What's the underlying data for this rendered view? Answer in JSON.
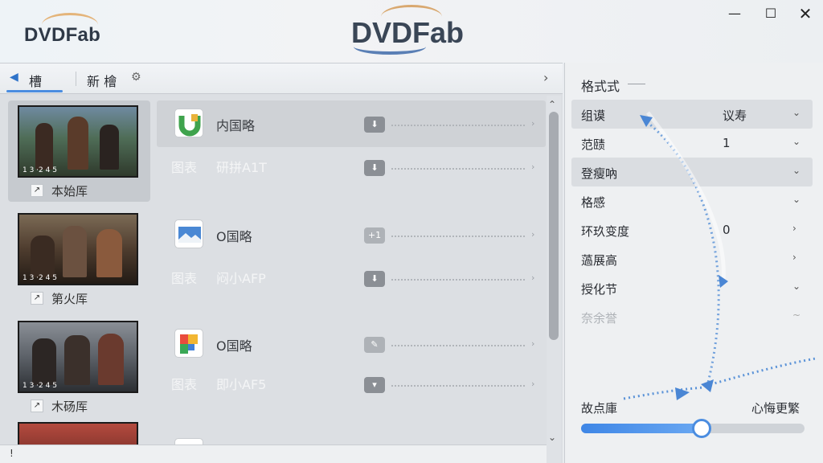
{
  "window": {
    "logo_small": "DVDFab",
    "logo_center": "DVDFab",
    "min_icon": "minimize-icon",
    "max_icon": "maximize-icon",
    "close_icon": "close-icon"
  },
  "tabs": {
    "tab1": "槽",
    "tab2": "新 檜",
    "gear_icon": "gear-icon",
    "back_icon": "back-arrow-icon",
    "next_icon": "chevron-right-icon"
  },
  "thumbnails": [
    {
      "caption": "1 3 ·2 4 5",
      "label": "本始厍"
    },
    {
      "caption": "1 3 ·2 4 5",
      "label": "第火厍"
    },
    {
      "caption": "1 3 ·2 4 5",
      "label": "木砀厍"
    }
  ],
  "rows": [
    {
      "title": "内国略",
      "sub_label": "图表",
      "sub_name": "研拼A1T",
      "badge1": "⬇",
      "badge2": "⬇"
    },
    {
      "title": "O国略",
      "sub_label": "图表",
      "sub_name": "闷小AFP",
      "badge1": "+1",
      "badge2": "⬇"
    },
    {
      "title": "O国略",
      "sub_label": "图表",
      "sub_name": "即小AF5",
      "badge1": "",
      "badge2": "▾"
    },
    {
      "title": "",
      "sub_label": "",
      "sub_name": "",
      "badge1": "",
      "badge2": ""
    }
  ],
  "statusbar": {
    "text": "!"
  },
  "settings": {
    "title": "格式式",
    "rows": [
      {
        "label": "组谟",
        "value": "议寿",
        "chevron": "⌄"
      },
      {
        "label": "范赜",
        "value": "1",
        "chevron": "⌄"
      },
      {
        "label": "登瘦吶",
        "value": "",
        "chevron": "⌄"
      },
      {
        "label": "格感",
        "value": "",
        "chevron": "⌄"
      },
      {
        "label": "环玖变度",
        "value": "0",
        "chevron": "›"
      },
      {
        "label": "薖展高",
        "value": "",
        "chevron": "›"
      },
      {
        "label": "授化节",
        "value": "",
        "chevron": "⌄"
      },
      {
        "label": "奈余誉",
        "value": "",
        "chevron": "~"
      }
    ],
    "slider_left": "故点庫",
    "slider_right": "心悔更繁",
    "slider_level": 0.54
  }
}
